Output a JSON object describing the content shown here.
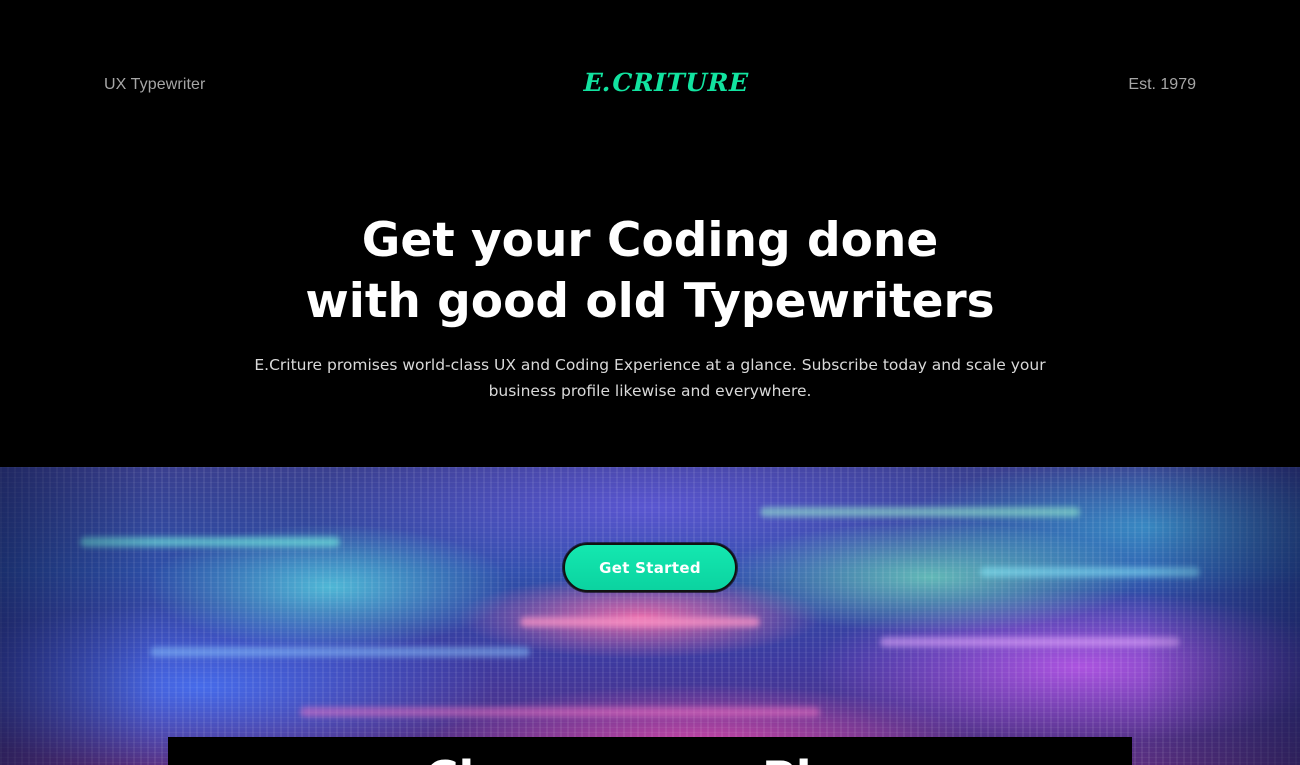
{
  "nav": {
    "left_text": "UX Typewriter",
    "logo": "E.CRITURE",
    "right_text": "Est. 1979"
  },
  "hero": {
    "title_line1": "Get your Coding done",
    "title_line2": "with good old Typewriters",
    "subtitle": "E.Criture promises world-class UX and Coding Experience at a glance. Subscribe today and scale your business profile likewise and everywhere."
  },
  "cta": {
    "label": "Get Started"
  },
  "panel": {
    "heading": "Choose your Plan"
  },
  "colors": {
    "background": "#000000",
    "accent": "#12E3A0",
    "nav_text": "#A6A6A6",
    "body_text": "#FFFFFF"
  }
}
